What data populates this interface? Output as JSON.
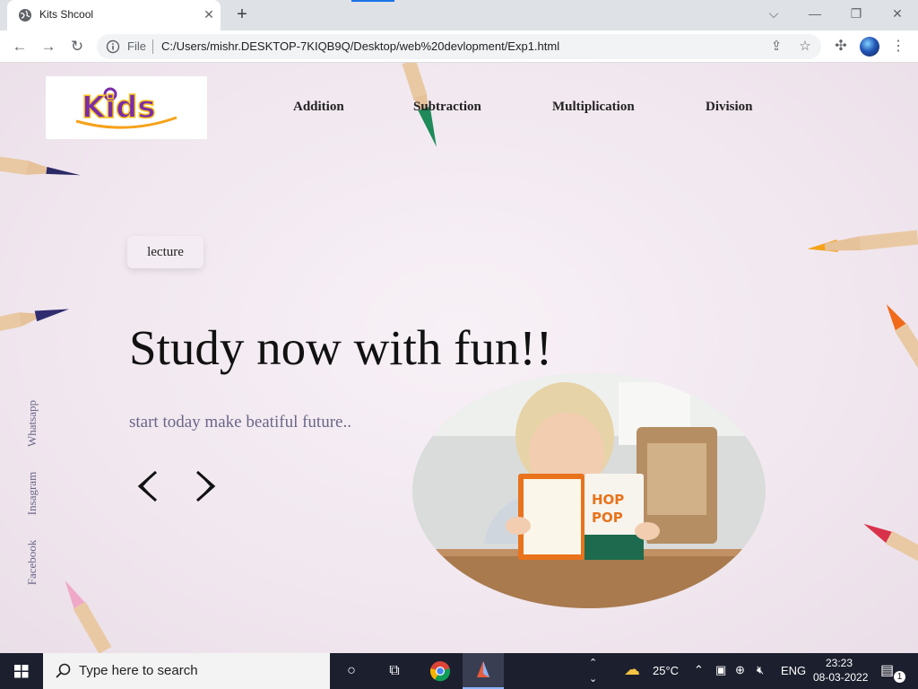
{
  "browser": {
    "tab_title": "Kits Shcool",
    "address_label": "File",
    "url": "C:/Users/mishr.DESKTOP-7KIQB9Q/Desktop/web%20devlopment/Exp1.html"
  },
  "site": {
    "logo_text": "Kids",
    "nav": [
      "Addition",
      "Subtraction",
      "Multiplication",
      "Division"
    ],
    "lecture_label": "lecture",
    "hero_title": "Study now with fun!!",
    "hero_subtitle": "start today make beatiful future..",
    "social": [
      "Whatsapp",
      "Insagram",
      "Facebook"
    ]
  },
  "taskbar": {
    "search_placeholder": "Type here to search",
    "temperature": "25°C",
    "language": "ENG",
    "time": "23:23",
    "date": "08-03-2022",
    "notification_count": "1"
  },
  "colors": {
    "page_background": "#f1e7ef",
    "subtitle_text": "#6a6688",
    "taskbar": "#1c1f2e"
  }
}
